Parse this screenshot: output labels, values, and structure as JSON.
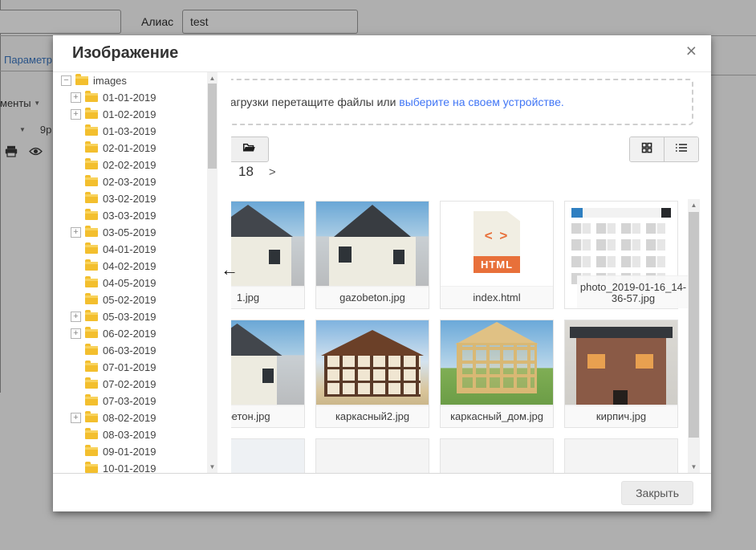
{
  "background": {
    "alias_label": "Алиас",
    "alias_value": "test",
    "params_tab": "Параметр",
    "documents_menu": "менты",
    "font_size_value": "9р"
  },
  "modal": {
    "title": "Изображение",
    "upload_text": "Для загрузки перетащите файлы или",
    "upload_link": "выберите на своем устройстве.",
    "breadcrumb_path": "18",
    "close_button": "Закрыть"
  },
  "icons": {
    "close": "×",
    "collapse_tree": "←",
    "chevron_right": ">",
    "scroll_up": "▲",
    "scroll_down": "▼",
    "dropdown_caret": "▼"
  },
  "colors": {
    "link_blue": "#4176f5",
    "folder_yellow": "#f3bf2e",
    "html_orange": "#e8703a",
    "overlay": "rgba(0,0,0,0.30)"
  },
  "tree": {
    "root": {
      "label": "images",
      "expander": "minus"
    },
    "items": [
      {
        "label": "01-01-2019",
        "expander": "plus"
      },
      {
        "label": "01-02-2019",
        "expander": "plus"
      },
      {
        "label": "01-03-2019",
        "expander": "none"
      },
      {
        "label": "02-01-2019",
        "expander": "none"
      },
      {
        "label": "02-02-2019",
        "expander": "none"
      },
      {
        "label": "02-03-2019",
        "expander": "none"
      },
      {
        "label": "03-02-2019",
        "expander": "none"
      },
      {
        "label": "03-03-2019",
        "expander": "none"
      },
      {
        "label": "03-05-2019",
        "expander": "plus"
      },
      {
        "label": "04-01-2019",
        "expander": "none"
      },
      {
        "label": "04-02-2019",
        "expander": "none"
      },
      {
        "label": "04-05-2019",
        "expander": "none"
      },
      {
        "label": "05-02-2019",
        "expander": "none"
      },
      {
        "label": "05-03-2019",
        "expander": "plus"
      },
      {
        "label": "06-02-2019",
        "expander": "plus"
      },
      {
        "label": "06-03-2019",
        "expander": "none"
      },
      {
        "label": "07-01-2019",
        "expander": "none"
      },
      {
        "label": "07-02-2019",
        "expander": "none"
      },
      {
        "label": "07-03-2019",
        "expander": "none"
      },
      {
        "label": "08-02-2019",
        "expander": "plus"
      },
      {
        "label": "08-03-2019",
        "expander": "none"
      },
      {
        "label": "09-01-2019",
        "expander": "none"
      },
      {
        "label": "10-01-2019",
        "expander": "none"
      }
    ]
  },
  "files": [
    {
      "caption": "1.jpg",
      "kind": "house-a"
    },
    {
      "caption": "gazobeton.jpg",
      "kind": "house-b"
    },
    {
      "caption": "index.html",
      "kind": "html-file",
      "icon_code": "< >",
      "icon_label": "HTML"
    },
    {
      "caption": "photo_2019-01-16_14-36-57.jpg",
      "kind": "screenshot"
    },
    {
      "caption": "бетон.jpg",
      "kind": "house-c"
    },
    {
      "caption": "каркасный2.jpg",
      "kind": "tudor-house"
    },
    {
      "caption": "каркасный_дом.jpg",
      "kind": "frame-house"
    },
    {
      "caption": "кирпич.jpg",
      "kind": "brick-house"
    },
    {
      "caption": "",
      "kind": "roof-peak"
    },
    {
      "caption": "",
      "kind": "people-field"
    },
    {
      "caption": "",
      "kind": "harvest-field"
    },
    {
      "caption": "",
      "kind": "veggies-collage"
    }
  ]
}
